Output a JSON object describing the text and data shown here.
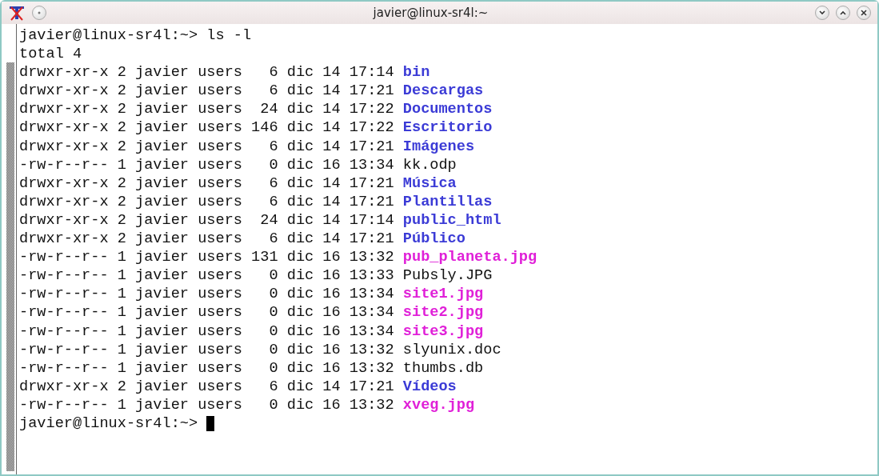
{
  "window": {
    "title": "javier@linux-sr4l:~"
  },
  "terminal": {
    "command_line": {
      "prompt": "javier@linux-sr4l:~>",
      "command": "ls -l"
    },
    "total": "total 4",
    "entries": [
      {
        "info": "drwxr-xr-x 2 javier users   6 dic 14 17:14",
        "name": "bin",
        "kind": "dir"
      },
      {
        "info": "drwxr-xr-x 2 javier users   6 dic 14 17:21",
        "name": "Descargas",
        "kind": "dir"
      },
      {
        "info": "drwxr-xr-x 2 javier users  24 dic 14 17:22",
        "name": "Documentos",
        "kind": "dir"
      },
      {
        "info": "drwxr-xr-x 2 javier users 146 dic 14 17:22",
        "name": "Escritorio",
        "kind": "dir"
      },
      {
        "info": "drwxr-xr-x 2 javier users   6 dic 14 17:21",
        "name": "Imágenes",
        "kind": "dir"
      },
      {
        "info": "-rw-r--r-- 1 javier users   0 dic 16 13:34",
        "name": "kk.odp",
        "kind": "file"
      },
      {
        "info": "drwxr-xr-x 2 javier users   6 dic 14 17:21",
        "name": "Música",
        "kind": "dir"
      },
      {
        "info": "drwxr-xr-x 2 javier users   6 dic 14 17:21",
        "name": "Plantillas",
        "kind": "dir"
      },
      {
        "info": "drwxr-xr-x 2 javier users  24 dic 14 17:14",
        "name": "public_html",
        "kind": "dir"
      },
      {
        "info": "drwxr-xr-x 2 javier users   6 dic 14 17:21",
        "name": "Público",
        "kind": "dir"
      },
      {
        "info": "-rw-r--r-- 1 javier users 131 dic 16 13:32",
        "name": "pub_planeta.jpg",
        "kind": "image"
      },
      {
        "info": "-rw-r--r-- 1 javier users   0 dic 16 13:33",
        "name": "Pubsly.JPG",
        "kind": "file"
      },
      {
        "info": "-rw-r--r-- 1 javier users   0 dic 16 13:34",
        "name": "site1.jpg",
        "kind": "image"
      },
      {
        "info": "-rw-r--r-- 1 javier users   0 dic 16 13:34",
        "name": "site2.jpg",
        "kind": "image"
      },
      {
        "info": "-rw-r--r-- 1 javier users   0 dic 16 13:34",
        "name": "site3.jpg",
        "kind": "image"
      },
      {
        "info": "-rw-r--r-- 1 javier users   0 dic 16 13:32",
        "name": "slyunix.doc",
        "kind": "file"
      },
      {
        "info": "-rw-r--r-- 1 javier users   0 dic 16 13:32",
        "name": "thumbs.db",
        "kind": "file"
      },
      {
        "info": "drwxr-xr-x 2 javier users   6 dic 14 17:21",
        "name": "Vídeos",
        "kind": "dir"
      },
      {
        "info": "-rw-r--r-- 1 javier users   0 dic 16 13:32",
        "name": "xveg.jpg",
        "kind": "image"
      }
    ],
    "prompt": "javier@linux-sr4l:~>"
  }
}
